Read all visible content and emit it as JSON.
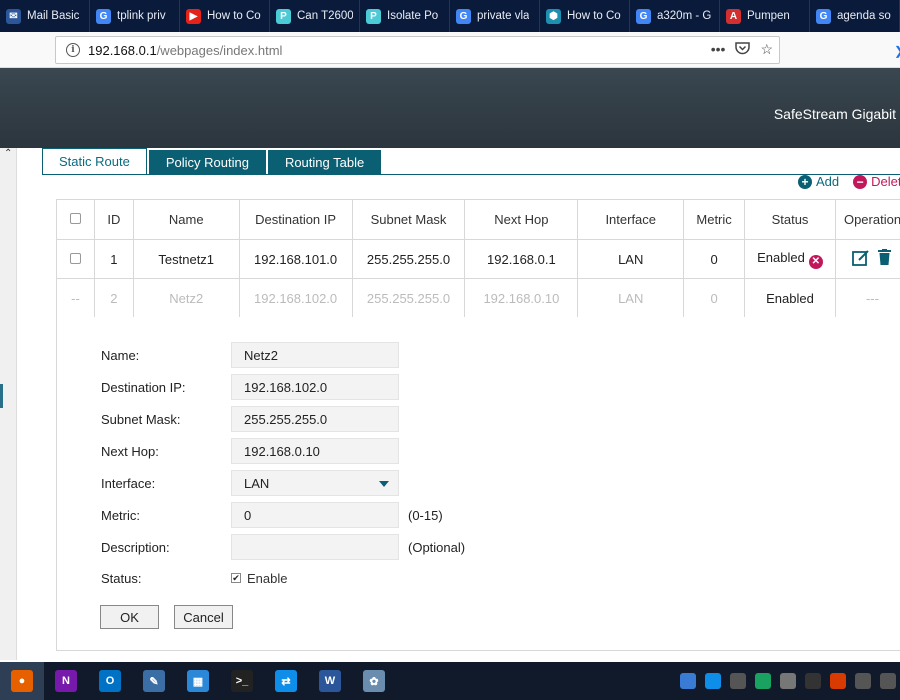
{
  "browser": {
    "tabs": [
      {
        "title": "Mail Basic",
        "icon": "mail-icon",
        "color": "#2b579a",
        "glyph": "✉"
      },
      {
        "title": "tplink priv",
        "icon": "google-icon",
        "color": "#4285f4",
        "glyph": "G"
      },
      {
        "title": "How to Co",
        "icon": "youtube-icon",
        "color": "#e62117",
        "glyph": "▶"
      },
      {
        "title": "Can T2600",
        "icon": "tplink-icon",
        "color": "#4acbd6",
        "glyph": "P"
      },
      {
        "title": "Isolate Po",
        "icon": "tplink-icon",
        "color": "#4acbd6",
        "glyph": "P"
      },
      {
        "title": "private vla",
        "icon": "google-icon",
        "color": "#4285f4",
        "glyph": "G"
      },
      {
        "title": "How to Co",
        "icon": "security-icon",
        "color": "#1d8fb0",
        "glyph": "⬢"
      },
      {
        "title": "a320m - G",
        "icon": "google-icon",
        "color": "#4285f4",
        "glyph": "G"
      },
      {
        "title": "Pumpen",
        "icon": "pdf-icon",
        "color": "#d32f2f",
        "glyph": "A"
      },
      {
        "title": "agenda so",
        "icon": "google-icon",
        "color": "#4285f4",
        "glyph": "G"
      }
    ],
    "new_tab": "+",
    "url_host": "192.168.0.1",
    "url_path": "/webpages/index.html",
    "url_menu": "•••"
  },
  "header": {
    "product": "SafeStream Gigabit"
  },
  "page_tabs": [
    "Static Route",
    "Policy Routing",
    "Routing Table"
  ],
  "toolbar": {
    "add": "Add",
    "delete": "Delete"
  },
  "table": {
    "columns": [
      "ID",
      "Name",
      "Destination IP",
      "Subnet Mask",
      "Next Hop",
      "Interface",
      "Metric",
      "Status",
      "Operation"
    ],
    "rows": [
      {
        "check": "",
        "id": "1",
        "name": "Testnetz1",
        "dest": "192.168.101.0",
        "mask": "255.255.255.0",
        "hop": "192.168.0.1",
        "iface": "LAN",
        "metric": "0",
        "status": "Enabled",
        "op": ""
      },
      {
        "check": "--",
        "id": "2",
        "name": "Netz2",
        "dest": "192.168.102.0",
        "mask": "255.255.255.0",
        "hop": "192.168.0.10",
        "iface": "LAN",
        "metric": "0",
        "status": "Enabled",
        "op": "---"
      }
    ]
  },
  "form": {
    "name_label": "Name:",
    "name_value": "Netz2",
    "dest_label": "Destination IP:",
    "dest_value": "192.168.102.0",
    "mask_label": "Subnet Mask:",
    "mask_value": "255.255.255.0",
    "hop_label": "Next Hop:",
    "hop_value": "192.168.0.10",
    "iface_label": "Interface:",
    "iface_value": "LAN",
    "metric_label": "Metric:",
    "metric_value": "0",
    "metric_hint": "(0-15)",
    "desc_label": "Description:",
    "desc_value": "",
    "desc_hint": "(Optional)",
    "status_label": "Status:",
    "status_option": "Enable",
    "status_checked": true,
    "ok": "OK",
    "cancel": "Cancel"
  },
  "taskbar": {
    "apps": [
      {
        "name": "firefox-icon",
        "color": "#e66000",
        "glyph": "●"
      },
      {
        "name": "onenote-icon",
        "color": "#7719aa",
        "glyph": "N"
      },
      {
        "name": "outlook-icon",
        "color": "#0072c6",
        "glyph": "O"
      },
      {
        "name": "notepad-icon",
        "color": "#3a6ea5",
        "glyph": "✎"
      },
      {
        "name": "network-icon",
        "color": "#2b88d8",
        "glyph": "▦"
      },
      {
        "name": "terminal-icon",
        "color": "#222222",
        "glyph": ">_"
      },
      {
        "name": "teamviewer-icon",
        "color": "#0e8ee9",
        "glyph": "⇄"
      },
      {
        "name": "word-icon",
        "color": "#2b579a",
        "glyph": "W"
      },
      {
        "name": "paint-icon",
        "color": "#6a8caf",
        "glyph": "✿"
      }
    ],
    "tray": [
      {
        "name": "tray-app-icon",
        "color": "#3a7bd5"
      },
      {
        "name": "tray-teamviewer-icon",
        "color": "#0e8ee9"
      },
      {
        "name": "tray-nx-icon",
        "color": "#555555"
      },
      {
        "name": "tray-cloud-icon",
        "color": "#1aa260"
      },
      {
        "name": "tray-vpn-icon",
        "color": "#777777"
      },
      {
        "name": "tray-shield-icon",
        "color": "#333333"
      },
      {
        "name": "tray-office-icon",
        "color": "#d83b01"
      },
      {
        "name": "tray-network-icon",
        "color": "#555555"
      },
      {
        "name": "tray-speaker-icon",
        "color": "#555555"
      }
    ]
  }
}
